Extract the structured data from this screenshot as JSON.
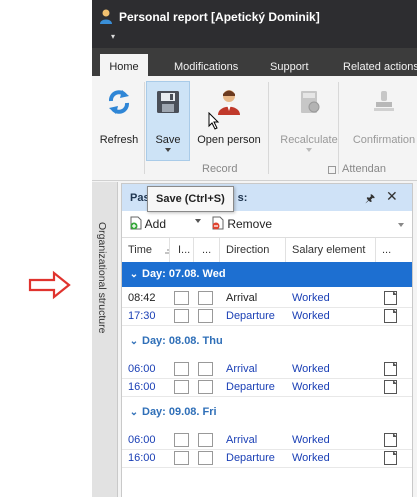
{
  "window": {
    "title": "Personal report [Apetický Dominik]",
    "menu_glyph": "▾"
  },
  "ribbon": {
    "tabs": [
      {
        "label": "Home",
        "active": true
      },
      {
        "label": "Modifications",
        "active": false
      },
      {
        "label": "Support",
        "active": false
      },
      {
        "label": "Related actions",
        "active": false
      }
    ],
    "buttons": {
      "refresh": "Refresh",
      "save": "Save",
      "open_person": "Open person",
      "recalculate": "Recalculate",
      "confirmation": "Confirmation"
    },
    "groups": {
      "record": "Record",
      "attendance": "Attendan"
    }
  },
  "tooltip": {
    "text": "Save (Ctrl+S)"
  },
  "side_panel": {
    "label": "Organizational structure"
  },
  "panel": {
    "title": "Pas",
    "title_suffix": "s:",
    "pin": "⊣",
    "close": "✕",
    "toolbar": {
      "add": "Add",
      "remove": "Remove"
    },
    "columns": {
      "time": "Time",
      "i": "I...",
      "dots": "...",
      "direction": "Direction",
      "salary": "Salary element",
      "more": "..."
    },
    "days": [
      {
        "label": "Day: 07.08. Wed",
        "selected": true,
        "rows": [
          {
            "time": "08:42",
            "direction": "Arrival",
            "salary": "Worked",
            "style": "dark"
          },
          {
            "time": "17:30",
            "direction": "Departure",
            "salary": "Worked",
            "style": "blue"
          }
        ]
      },
      {
        "label": "Day: 08.08. Thu",
        "selected": false,
        "rows": [
          {
            "time": "06:00",
            "direction": "Arrival",
            "salary": "Worked",
            "style": "blue"
          },
          {
            "time": "16:00",
            "direction": "Departure",
            "salary": "Worked",
            "style": "blue"
          }
        ]
      },
      {
        "label": "Day: 09.08. Fri",
        "selected": false,
        "rows": [
          {
            "time": "06:00",
            "direction": "Arrival",
            "salary": "Worked",
            "style": "blue"
          },
          {
            "time": "16:00",
            "direction": "Departure",
            "salary": "Worked",
            "style": "blue"
          }
        ]
      }
    ]
  },
  "colors": {
    "accent": "#1d6fd1",
    "titlebar": "#2d2d30",
    "arrow": "#e0332e",
    "panel_header": "#cfe2f7"
  }
}
